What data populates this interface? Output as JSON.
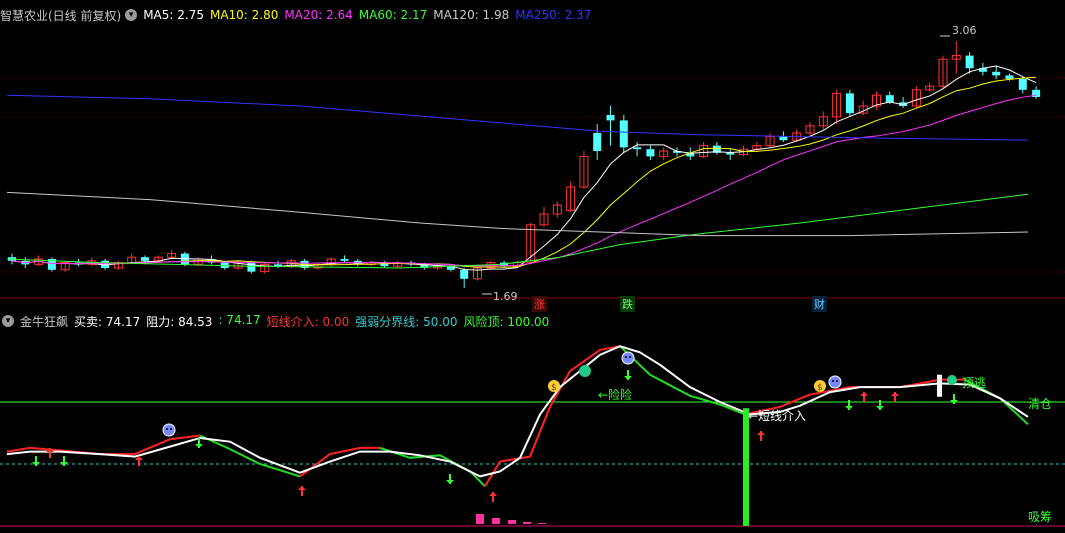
{
  "main": {
    "stock": "智慧农业(日线 前复权)",
    "ma": [
      {
        "label": "MA5: 2.75",
        "color": "#ffffff"
      },
      {
        "label": "MA10: 2.80",
        "color": "#ffff00"
      },
      {
        "label": "MA20: 2.64",
        "color": "#ff33ff"
      },
      {
        "label": "MA60: 2.17",
        "color": "#33ff33"
      },
      {
        "label": "MA120: 1.98",
        "color": "#c8c8c8"
      },
      {
        "label": "MA250: 2.37",
        "color": "#3333ff"
      }
    ],
    "high_label": "3.06",
    "low_label": "1.69",
    "events": [
      {
        "text": "涨",
        "color": "#ff3333",
        "bg": "#3a0a0a"
      },
      {
        "text": "跌",
        "color": "#66ff66",
        "bg": "#0a3a0a"
      },
      {
        "text": "财",
        "color": "#66ccff",
        "bg": "#0a1f3a"
      }
    ],
    "candles": [
      {
        "o": 1.86,
        "c": 1.84,
        "h": 1.88,
        "l": 1.82
      },
      {
        "o": 1.84,
        "c": 1.82,
        "h": 1.86,
        "l": 1.8
      },
      {
        "o": 1.82,
        "c": 1.85,
        "h": 1.87,
        "l": 1.81
      },
      {
        "o": 1.85,
        "c": 1.79,
        "h": 1.86,
        "l": 1.78
      },
      {
        "o": 1.79,
        "c": 1.83,
        "h": 1.84,
        "l": 1.78
      },
      {
        "o": 1.83,
        "c": 1.82,
        "h": 1.85,
        "l": 1.81
      },
      {
        "o": 1.82,
        "c": 1.84,
        "h": 1.86,
        "l": 1.81
      },
      {
        "o": 1.84,
        "c": 1.8,
        "h": 1.85,
        "l": 1.79
      },
      {
        "o": 1.8,
        "c": 1.83,
        "h": 1.84,
        "l": 1.79
      },
      {
        "o": 1.83,
        "c": 1.86,
        "h": 1.88,
        "l": 1.82
      },
      {
        "o": 1.86,
        "c": 1.84,
        "h": 1.87,
        "l": 1.82
      },
      {
        "o": 1.84,
        "c": 1.86,
        "h": 1.87,
        "l": 1.83
      },
      {
        "o": 1.86,
        "c": 1.88,
        "h": 1.9,
        "l": 1.85
      },
      {
        "o": 1.88,
        "c": 1.82,
        "h": 1.89,
        "l": 1.81
      },
      {
        "o": 1.82,
        "c": 1.85,
        "h": 1.86,
        "l": 1.81
      },
      {
        "o": 1.85,
        "c": 1.83,
        "h": 1.87,
        "l": 1.82
      },
      {
        "o": 1.83,
        "c": 1.8,
        "h": 1.84,
        "l": 1.79
      },
      {
        "o": 1.8,
        "c": 1.83,
        "h": 1.84,
        "l": 1.79
      },
      {
        "o": 1.83,
        "c": 1.78,
        "h": 1.84,
        "l": 1.77
      },
      {
        "o": 1.78,
        "c": 1.82,
        "h": 1.83,
        "l": 1.77
      },
      {
        "o": 1.82,
        "c": 1.81,
        "h": 1.84,
        "l": 1.8
      },
      {
        "o": 1.81,
        "c": 1.84,
        "h": 1.85,
        "l": 1.8
      },
      {
        "o": 1.84,
        "c": 1.8,
        "h": 1.85,
        "l": 1.79
      },
      {
        "o": 1.8,
        "c": 1.82,
        "h": 1.83,
        "l": 1.79
      },
      {
        "o": 1.82,
        "c": 1.85,
        "h": 1.86,
        "l": 1.81
      },
      {
        "o": 1.85,
        "c": 1.84,
        "h": 1.87,
        "l": 1.83
      },
      {
        "o": 1.84,
        "c": 1.82,
        "h": 1.85,
        "l": 1.81
      },
      {
        "o": 1.82,
        "c": 1.83,
        "h": 1.84,
        "l": 1.81
      },
      {
        "o": 1.83,
        "c": 1.81,
        "h": 1.84,
        "l": 1.8
      },
      {
        "o": 1.81,
        "c": 1.83,
        "h": 1.84,
        "l": 1.8
      },
      {
        "o": 1.83,
        "c": 1.82,
        "h": 1.84,
        "l": 1.81
      },
      {
        "o": 1.82,
        "c": 1.8,
        "h": 1.83,
        "l": 1.79
      },
      {
        "o": 1.8,
        "c": 1.81,
        "h": 1.82,
        "l": 1.79
      },
      {
        "o": 1.81,
        "c": 1.79,
        "h": 1.82,
        "l": 1.78
      },
      {
        "o": 1.79,
        "c": 1.74,
        "h": 1.8,
        "l": 1.69
      },
      {
        "o": 1.74,
        "c": 1.8,
        "h": 1.81,
        "l": 1.73
      },
      {
        "o": 1.8,
        "c": 1.83,
        "h": 1.84,
        "l": 1.79
      },
      {
        "o": 1.83,
        "c": 1.81,
        "h": 1.84,
        "l": 1.8
      },
      {
        "o": 1.81,
        "c": 1.83,
        "h": 1.84,
        "l": 1.8
      },
      {
        "o": 1.83,
        "c": 2.04,
        "h": 2.05,
        "l": 1.82
      },
      {
        "o": 2.04,
        "c": 2.1,
        "h": 2.14,
        "l": 2.03
      },
      {
        "o": 2.1,
        "c": 2.15,
        "h": 2.17,
        "l": 2.08
      },
      {
        "o": 2.12,
        "c": 2.25,
        "h": 2.28,
        "l": 2.11
      },
      {
        "o": 2.25,
        "c": 2.42,
        "h": 2.45,
        "l": 2.24
      },
      {
        "o": 2.55,
        "c": 2.45,
        "h": 2.6,
        "l": 2.4
      },
      {
        "o": 2.65,
        "c": 2.62,
        "h": 2.7,
        "l": 2.48
      },
      {
        "o": 2.62,
        "c": 2.47,
        "h": 2.65,
        "l": 2.44
      },
      {
        "o": 2.47,
        "c": 2.46,
        "h": 2.5,
        "l": 2.42
      },
      {
        "o": 2.46,
        "c": 2.42,
        "h": 2.48,
        "l": 2.4
      },
      {
        "o": 2.42,
        "c": 2.45,
        "h": 2.47,
        "l": 2.4
      },
      {
        "o": 2.45,
        "c": 2.44,
        "h": 2.47,
        "l": 2.42
      },
      {
        "o": 2.44,
        "c": 2.42,
        "h": 2.47,
        "l": 2.4
      },
      {
        "o": 2.42,
        "c": 2.48,
        "h": 2.5,
        "l": 2.41
      },
      {
        "o": 2.48,
        "c": 2.44,
        "h": 2.5,
        "l": 2.43
      },
      {
        "o": 2.44,
        "c": 2.43,
        "h": 2.46,
        "l": 2.4
      },
      {
        "o": 2.43,
        "c": 2.46,
        "h": 2.48,
        "l": 2.42
      },
      {
        "o": 2.46,
        "c": 2.48,
        "h": 2.5,
        "l": 2.45
      },
      {
        "o": 2.48,
        "c": 2.53,
        "h": 2.55,
        "l": 2.47
      },
      {
        "o": 2.53,
        "c": 2.51,
        "h": 2.56,
        "l": 2.5
      },
      {
        "o": 2.51,
        "c": 2.55,
        "h": 2.57,
        "l": 2.5
      },
      {
        "o": 2.55,
        "c": 2.59,
        "h": 2.61,
        "l": 2.54
      },
      {
        "o": 2.59,
        "c": 2.64,
        "h": 2.67,
        "l": 2.57
      },
      {
        "o": 2.64,
        "c": 2.77,
        "h": 2.79,
        "l": 2.6
      },
      {
        "o": 2.77,
        "c": 2.66,
        "h": 2.79,
        "l": 2.64
      },
      {
        "o": 2.66,
        "c": 2.7,
        "h": 2.73,
        "l": 2.65
      },
      {
        "o": 2.7,
        "c": 2.76,
        "h": 2.78,
        "l": 2.68
      },
      {
        "o": 2.76,
        "c": 2.72,
        "h": 2.78,
        "l": 2.71
      },
      {
        "o": 2.72,
        "c": 2.7,
        "h": 2.75,
        "l": 2.69
      },
      {
        "o": 2.7,
        "c": 2.79,
        "h": 2.81,
        "l": 2.69
      },
      {
        "o": 2.79,
        "c": 2.81,
        "h": 2.83,
        "l": 2.78
      },
      {
        "o": 2.81,
        "c": 2.96,
        "h": 2.98,
        "l": 2.8
      },
      {
        "o": 2.96,
        "c": 2.98,
        "h": 3.06,
        "l": 2.88
      },
      {
        "o": 2.98,
        "c": 2.91,
        "h": 3.0,
        "l": 2.88
      },
      {
        "o": 2.91,
        "c": 2.89,
        "h": 2.94,
        "l": 2.87
      },
      {
        "o": 2.89,
        "c": 2.87,
        "h": 2.92,
        "l": 2.85
      },
      {
        "o": 2.87,
        "c": 2.85,
        "h": 2.88,
        "l": 2.84
      },
      {
        "o": 2.85,
        "c": 2.79,
        "h": 2.86,
        "l": 2.77
      },
      {
        "o": 2.79,
        "c": 2.75,
        "h": 2.81,
        "l": 2.74
      }
    ]
  },
  "sub": {
    "name": "金牛狂飙",
    "items": [
      {
        "label": "买卖: 74.17",
        "color": "#ffffff"
      },
      {
        "label": "阻力: 84.53",
        "color": "#ffffff"
      },
      {
        "label": ": 74.17",
        "color": "#33ff33"
      },
      {
        "label": "短线介入: 0.00",
        "color": "#ff3333"
      },
      {
        "label": "强弱分界线: 50.00",
        "color": "#33cccc"
      },
      {
        "label": "风险顶: 100.00",
        "color": "#33ff33"
      }
    ],
    "risk_label": "←险险",
    "entry_label": "←短线介入",
    "top_escape_label": "顶逃",
    "clear_label": "清仓",
    "absorb_label": "吸筹"
  }
}
